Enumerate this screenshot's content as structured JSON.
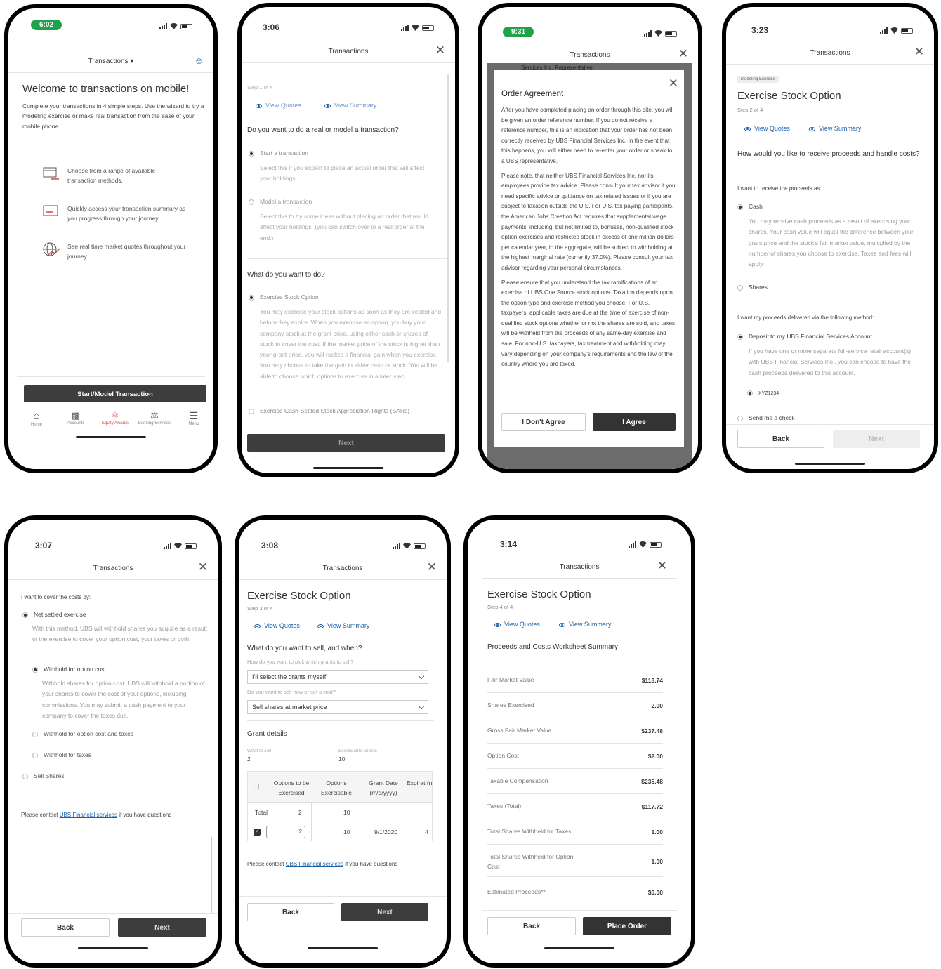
{
  "p1": {
    "time": "6:02",
    "title": "Transactions",
    "heading": "Welcome to transactions on mobile!",
    "intro": "Complete your transactions in 4 simple steps. Use the wizard to try a modeling exercise or make real transaction from the ease of your mobile phone.",
    "features": [
      "Choose from a range of available transaction methods.",
      "Quickly access your transaction summary as you progress through your journey.",
      "See real time market quotes throughout your journey."
    ],
    "cta": "Start/Model Transaction",
    "nav": [
      "Home",
      "Accounts",
      "Equity Awards",
      "Banking Services",
      "Menu"
    ]
  },
  "p2": {
    "time": "3:06",
    "title": "Transactions",
    "step": "Step 1 of 4",
    "view_quotes": "View Quotes",
    "view_summary": "View Summary",
    "q1": "Do you want to do a real or model a transaction?",
    "opt1": "Start a transaction",
    "opt1_desc": "Select this if you expect to place an actual order that will affect your holdings",
    "opt2": "Model a transaction",
    "opt2_desc": "Select this to try some ideas without placing an order that would affect your holdings. (you can switch over to a real order at the end.)",
    "q2": "What do you want to do?",
    "opt3": "Exercise Stock Option",
    "opt3_desc": "You may exercise your stock options as soon as they are vested and before they expire. When you exercise an option, you buy your company stock at the grant price, using either cash or shares of stock to cover the cost. If the market price of the stock is higher than your grant price, you will realize a financial gain when you exercise. You may choose to take the gain in either cash or stock. You will be able to choose which options to exercise in a later step.",
    "opt4": "Exercise Cash-Settled Stock Appreciation Rights (SARs)",
    "next": "Next"
  },
  "p3": {
    "time": "9:31",
    "title": "Transactions",
    "behind": "Services Inc. Representative",
    "modal_title": "Order Agreement",
    "para1": "After you have completed placing an order through this site, you will be given an order reference number. If you do not receive a reference number, this is an indication that your order has not been correctly received by UBS Financial Services Inc. In the event that this happens, you will either need to re-enter your order or speak to a UBS representative.",
    "para2": "Please note, that neither UBS Financial Services Inc. nor its employees provide tax advice. Please consult your tax advisor if you need specific advice or guidance on tax related issues or if you are subject to taxation outside the U.S. For U.S. tax paying participants, the American Jobs Creation Act requires that supplemental wage payments, including, but not limited to, bonuses, non-qualified stock option exercises and restricted stock in excess of one million dollars per calendar year, in the aggregate, will be subject to withholding at the highest marginal rate (currently 37.0%). Please consult your tax advisor regarding your personal circumstances.",
    "para3": "Please ensure that you understand the tax ramifications of an exercise of UBS One Source stock options. Taxation depends upon the option type and exercise method you choose. For U.S. taxpayers, applicable taxes are due at the time of exercise of non-qualified stock options whether or not the shares are sold, and taxes will be withheld from the proceeds of any same-day exercise and sale. For non-U.S. taxpayers, tax treatment and withholding may vary depending on your company's requirements and the law of the country where you are taxed.",
    "disagree": "I Don't Agree",
    "agree": "I Agree"
  },
  "p4": {
    "time": "3:23",
    "title": "Transactions",
    "badge": "Modeling Exercise",
    "heading": "Exercise Stock Option",
    "step": "Step 2 of 4",
    "view_quotes": "View Quotes",
    "view_summary": "View Summary",
    "q": "How would you like to receive proceeds and handle costs?",
    "sub1": "I want to receive the proceeds as:",
    "cash": "Cash",
    "cash_desc": "You may receive cash proceeds as a result of exercising your shares. Your cash value will equal the difference between your grant price and the stock's fair market value, multiplied by the number of shares you choose to exercise. Taxes and fees will apply.",
    "shares": "Shares",
    "sub2": "I want my proceeds delivered via the following method:",
    "deposit": "Deposit to my UBS Financial Services Account",
    "deposit_desc": "If you have one or more separate full-service retail account(s) with UBS Financial Services Inc., you can choose to have the cash proceeds delivered to this account.",
    "account": "XYZ1234",
    "check": "Send me a check",
    "back": "Back",
    "next": "Next"
  },
  "p5": {
    "time": "3:07",
    "title": "Transactions",
    "sub": "I want to cover the costs by:",
    "net": "Net settled exercise",
    "net_desc": "With this method, UBS will withhold shares you acquire as a result of the exercise to cover your option cost, your taxes or both.",
    "w1": "Withhold for option cost",
    "w1_desc": "Withhold shares for option cost. UBS will withhold a portion of your shares to cover the cost of your options, including commissions. You may submit a cash payment to your company to cover the taxes due.",
    "w2": "Withhold for option cost and taxes",
    "w3": "Withhold for taxes",
    "sell": "Sell Shares",
    "contact_pre": "Please contact",
    "contact_link": "UBS Financial services",
    "contact_post": "if you have questions",
    "back": "Back",
    "next": "Next"
  },
  "p6": {
    "time": "3:08",
    "title": "Transactions",
    "heading": "Exercise Stock Option",
    "step": "Step 3 of 4",
    "view_quotes": "View Quotes",
    "view_summary": "View Summary",
    "q": "What do you want to sell, and when?",
    "l1": "How do you want to pick which grants to sell?",
    "s1": "I'll select the grants myself",
    "l2": "Do you want to sell now or set a limit?",
    "s2": "Sell shares at market price",
    "grant": "Grant details",
    "what_label": "What to sell",
    "what_val": "2",
    "exer_label": "Exercisable Grants",
    "exer_val": "10",
    "cols": [
      "Options to be Exercised",
      "Options Exercisable",
      "Grant Date (m/d/yyyy)",
      "Expirat (n"
    ],
    "total_label": "Total",
    "total_opt": "2",
    "total_exer": "10",
    "row_input": "2",
    "row_exer": "10",
    "row_date": "9/1/2020",
    "row_exp": "4",
    "contact_pre": "Please contact",
    "contact_link": "UBS Financial services",
    "contact_post": "if you have questions",
    "back": "Back",
    "next": "Next"
  },
  "p7": {
    "time": "3:14",
    "title": "Transactions",
    "heading": "Exercise Stock Option",
    "step": "Step 4 of 4",
    "view_quotes": "View Quotes",
    "view_summary": "View Summary",
    "summary": "Proceeds and Costs Worksheet Summary",
    "rows": [
      {
        "label": "Fair Market Value",
        "value": "$118.74"
      },
      {
        "label": "Shares Exercised",
        "value": "2.00"
      },
      {
        "label": "Gross Fair Market Value",
        "value": "$237.48"
      },
      {
        "label": "Option Cost",
        "value": "$2.00"
      },
      {
        "label": "Taxable Compensation",
        "value": "$235.48"
      },
      {
        "label": "Taxes (Total)",
        "value": "$117.72"
      },
      {
        "label": "Total Shares Withheld for Taxes",
        "value": "1.00"
      },
      {
        "label": "Total Shares Withheld for Option Cost",
        "value": "1.00"
      },
      {
        "label": "Estimated Proceeds**",
        "value": "$0.00"
      }
    ],
    "back": "Back",
    "place": "Place Order"
  }
}
